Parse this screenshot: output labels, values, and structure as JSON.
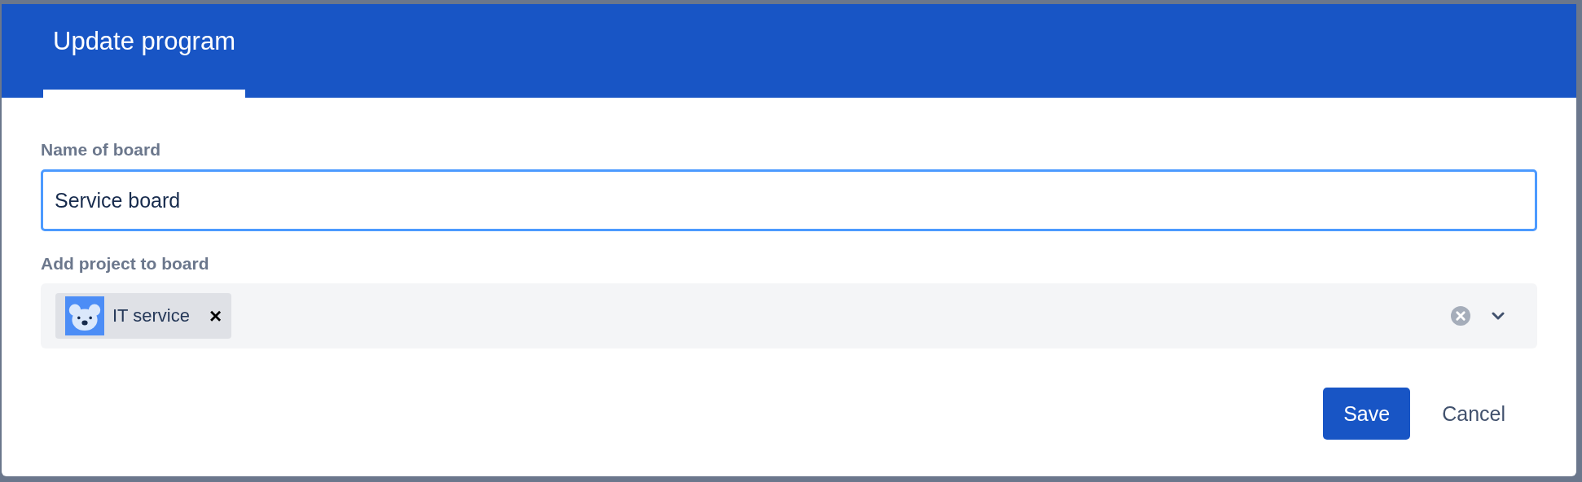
{
  "dialog": {
    "tabs": [
      {
        "label": "Update program",
        "selected": true
      }
    ]
  },
  "fields": [
    {
      "label": "Name of board",
      "value": "Service board"
    }
  ],
  "project_select": {
    "label": "Add project to board",
    "chips": [
      {
        "label": "IT service",
        "remove": "×"
      }
    ]
  },
  "buttons": [
    {
      "label": "Save",
      "kind": "primary"
    },
    {
      "label": "Cancel",
      "kind": "subtle"
    }
  ]
}
